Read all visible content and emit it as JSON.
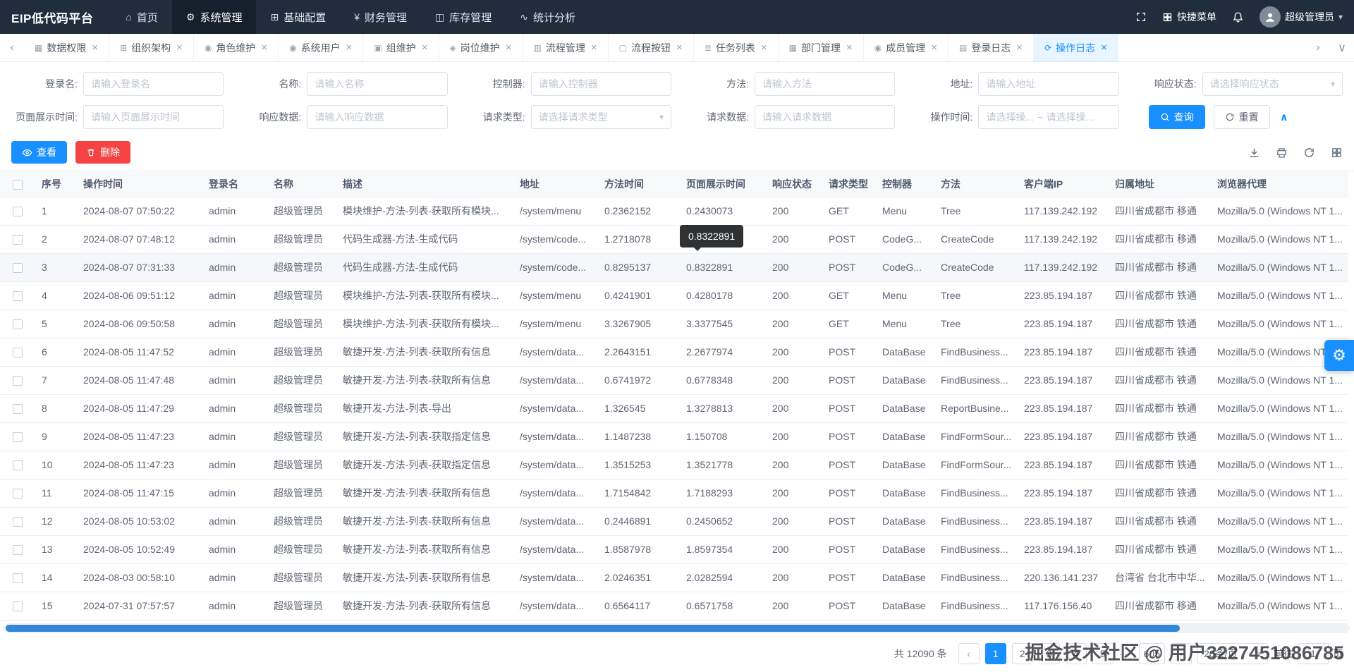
{
  "colors": {
    "primary": "#1890ff",
    "danger": "#f54343",
    "navbar_bg": "#1f2d3d",
    "active_tab_bg": "#e8f4ff",
    "tooltip_bg": "#303133",
    "scrollbar_thumb": "#3385d6"
  },
  "navbar": {
    "logo": "EIP低代码平台",
    "items": [
      {
        "key": "home",
        "label": "首页",
        "icon": "home-icon",
        "glyph": "⌂",
        "active": false
      },
      {
        "key": "system",
        "label": "系统管理",
        "icon": "system-gear-icon",
        "glyph": "⚙",
        "active": true
      },
      {
        "key": "base-config",
        "label": "基础配置",
        "icon": "base-config-icon",
        "glyph": "⊞",
        "active": false
      },
      {
        "key": "finance",
        "label": "财务管理",
        "icon": "finance-icon",
        "glyph": "¥",
        "active": false
      },
      {
        "key": "inventory",
        "label": "库存管理",
        "icon": "inventory-icon",
        "glyph": "◫",
        "active": false
      },
      {
        "key": "stats",
        "label": "统计分析",
        "icon": "stats-icon",
        "glyph": "∿",
        "active": false
      }
    ],
    "quick_menu_label": "快捷菜单",
    "user_name": "超级管理员"
  },
  "tabs": [
    {
      "key": "data-permission",
      "label": "数据权限",
      "icon": "data-grid-icon",
      "glyph": "▦",
      "active": false
    },
    {
      "key": "org-structure",
      "label": "组织架构",
      "icon": "org-icon",
      "glyph": "⊞",
      "active": false
    },
    {
      "key": "role-maintain",
      "label": "角色维护",
      "icon": "role-icon",
      "glyph": "◉",
      "active": false
    },
    {
      "key": "system-user",
      "label": "系统用户",
      "icon": "user-icon",
      "glyph": "◉",
      "active": false
    },
    {
      "key": "group-maintain",
      "label": "组维护",
      "icon": "group-icon",
      "glyph": "▣",
      "active": false
    },
    {
      "key": "position-maintain",
      "label": "岗位维护",
      "icon": "position-icon",
      "glyph": "◈",
      "active": false
    },
    {
      "key": "process-manage",
      "label": "流程管理",
      "icon": "process-icon",
      "glyph": "▥",
      "active": false
    },
    {
      "key": "process-button",
      "label": "流程按钮",
      "icon": "process-button-icon",
      "glyph": "▢",
      "active": false
    },
    {
      "key": "task-list",
      "label": "任务列表",
      "icon": "task-list-icon",
      "glyph": "≣",
      "active": false
    },
    {
      "key": "department-manage",
      "label": "部门管理",
      "icon": "department-icon",
      "glyph": "▦",
      "active": false
    },
    {
      "key": "member-manage",
      "label": "成员管理",
      "icon": "member-icon",
      "glyph": "◉",
      "active": false
    },
    {
      "key": "login-log",
      "label": "登录日志",
      "icon": "login-log-icon",
      "glyph": "▤",
      "active": false
    },
    {
      "key": "operation-log",
      "label": "操作日志",
      "icon": "loading-refresh-icon",
      "glyph": "⟳",
      "active": true
    }
  ],
  "search": {
    "rows": [
      [
        {
          "key": "login-name",
          "label": "登录名:",
          "placeholder": "请输入登录名",
          "type": "input"
        },
        {
          "key": "name",
          "label": "名称:",
          "placeholder": "请输入名称",
          "type": "input"
        },
        {
          "key": "controller",
          "label": "控制器:",
          "placeholder": "请输入控制器",
          "type": "input"
        },
        {
          "key": "method",
          "label": "方法:",
          "placeholder": "请输入方法",
          "type": "input"
        },
        {
          "key": "address",
          "label": "地址:",
          "placeholder": "请输入地址",
          "type": "input"
        },
        {
          "key": "response-status",
          "label": "响应状态:",
          "placeholder": "请选择响应状态",
          "type": "select"
        }
      ],
      [
        {
          "key": "page-display-time",
          "label": "页面展示时间:",
          "placeholder": "请输入页面展示时间",
          "type": "input"
        },
        {
          "key": "response-data",
          "label": "响应数据:",
          "placeholder": "请输入响应数据",
          "type": "input"
        },
        {
          "key": "request-type",
          "label": "请求类型:",
          "placeholder": "请选择请求类型",
          "type": "select"
        },
        {
          "key": "request-data",
          "label": "请求数据:",
          "placeholder": "请输入请求数据",
          "type": "input"
        },
        {
          "key": "operation-time",
          "label": "操作时间:",
          "placeholder_start": "请选择操...",
          "separator": "~",
          "placeholder_end": "请选择操...",
          "type": "range"
        }
      ]
    ],
    "query_label": "查询",
    "reset_label": "重置"
  },
  "toolbar": {
    "view_label": "查看",
    "delete_label": "删除",
    "icon_buttons": [
      "download-icon",
      "printer-icon",
      "refresh-icon",
      "column-settings-icon"
    ]
  },
  "table": {
    "columns": [
      "序号",
      "操作时间",
      "登录名",
      "名称",
      "描述",
      "地址",
      "方法时间",
      "页面展示时间",
      "响应状态",
      "请求类型",
      "控制器",
      "方法",
      "客户端IP",
      "归属地址",
      "浏览器代理"
    ],
    "hovered_row_index": 2,
    "rows": [
      [
        "1",
        "2024-08-07 07:50:22",
        "admin",
        "超级管理员",
        "模块维护-方法-列表-获取所有模块...",
        "/system/menu",
        "0.2362152",
        "0.2430073",
        "200",
        "GET",
        "Menu",
        "Tree",
        "117.139.242.192",
        "四川省成都市 移通",
        "Mozilla/5.0 (Windows NT 1..."
      ],
      [
        "2",
        "2024-08-07 07:48:12",
        "admin",
        "超级管理员",
        "代码生成器-方法-生成代码",
        "/system/code...",
        "1.2718078",
        "",
        "200",
        "POST",
        "CodeG...",
        "CreateCode",
        "117.139.242.192",
        "四川省成都市 移通",
        "Mozilla/5.0 (Windows NT 1..."
      ],
      [
        "3",
        "2024-08-07 07:31:33",
        "admin",
        "超级管理员",
        "代码生成器-方法-生成代码",
        "/system/code...",
        "0.8295137",
        "0.8322891",
        "200",
        "POST",
        "CodeG...",
        "CreateCode",
        "117.139.242.192",
        "四川省成都市 移通",
        "Mozilla/5.0 (Windows NT 1..."
      ],
      [
        "4",
        "2024-08-06 09:51:12",
        "admin",
        "超级管理员",
        "模块维护-方法-列表-获取所有模块...",
        "/system/menu",
        "0.4241901",
        "0.4280178",
        "200",
        "GET",
        "Menu",
        "Tree",
        "223.85.194.187",
        "四川省成都市 铁通",
        "Mozilla/5.0 (Windows NT 1..."
      ],
      [
        "5",
        "2024-08-06 09:50:58",
        "admin",
        "超级管理员",
        "模块维护-方法-列表-获取所有模块...",
        "/system/menu",
        "3.3267905",
        "3.3377545",
        "200",
        "GET",
        "Menu",
        "Tree",
        "223.85.194.187",
        "四川省成都市 铁通",
        "Mozilla/5.0 (Windows NT 1..."
      ],
      [
        "6",
        "2024-08-05 11:47:52",
        "admin",
        "超级管理员",
        "敏捷开发-方法-列表-获取所有信息",
        "/system/data...",
        "2.2643151",
        "2.2677974",
        "200",
        "POST",
        "DataBase",
        "FindBusiness...",
        "223.85.194.187",
        "四川省成都市 铁通",
        "Mozilla/5.0 (Windows NT 1..."
      ],
      [
        "7",
        "2024-08-05 11:47:48",
        "admin",
        "超级管理员",
        "敏捷开发-方法-列表-获取所有信息",
        "/system/data...",
        "0.6741972",
        "0.6778348",
        "200",
        "POST",
        "DataBase",
        "FindBusiness...",
        "223.85.194.187",
        "四川省成都市 铁通",
        "Mozilla/5.0 (Windows NT 1..."
      ],
      [
        "8",
        "2024-08-05 11:47:29",
        "admin",
        "超级管理员",
        "敏捷开发-方法-列表-导出",
        "/system/data...",
        "1.326545",
        "1.3278813",
        "200",
        "POST",
        "DataBase",
        "ReportBusine...",
        "223.85.194.187",
        "四川省成都市 铁通",
        "Mozilla/5.0 (Windows NT 1..."
      ],
      [
        "9",
        "2024-08-05 11:47:23",
        "admin",
        "超级管理员",
        "敏捷开发-方法-列表-获取指定信息",
        "/system/data...",
        "1.1487238",
        "1.150708",
        "200",
        "POST",
        "DataBase",
        "FindFormSour...",
        "223.85.194.187",
        "四川省成都市 铁通",
        "Mozilla/5.0 (Windows NT 1..."
      ],
      [
        "10",
        "2024-08-05 11:47:23",
        "admin",
        "超级管理员",
        "敏捷开发-方法-列表-获取指定信息",
        "/system/data...",
        "1.3515253",
        "1.3521778",
        "200",
        "POST",
        "DataBase",
        "FindFormSour...",
        "223.85.194.187",
        "四川省成都市 铁通",
        "Mozilla/5.0 (Windows NT 1..."
      ],
      [
        "11",
        "2024-08-05 11:47:15",
        "admin",
        "超级管理员",
        "敏捷开发-方法-列表-获取所有信息",
        "/system/data...",
        "1.7154842",
        "1.7188293",
        "200",
        "POST",
        "DataBase",
        "FindBusiness...",
        "223.85.194.187",
        "四川省成都市 铁通",
        "Mozilla/5.0 (Windows NT 1..."
      ],
      [
        "12",
        "2024-08-05 10:53:02",
        "admin",
        "超级管理员",
        "敏捷开发-方法-列表-获取所有信息",
        "/system/data...",
        "0.2446891",
        "0.2450652",
        "200",
        "POST",
        "DataBase",
        "FindBusiness...",
        "223.85.194.187",
        "四川省成都市 铁通",
        "Mozilla/5.0 (Windows NT 1..."
      ],
      [
        "13",
        "2024-08-05 10:52:49",
        "admin",
        "超级管理员",
        "敏捷开发-方法-列表-获取所有信息",
        "/system/data...",
        "1.8587978",
        "1.8597354",
        "200",
        "POST",
        "DataBase",
        "FindBusiness...",
        "223.85.194.187",
        "四川省成都市 铁通",
        "Mozilla/5.0 (Windows NT 1..."
      ],
      [
        "14",
        "2024-08-03 00:58:10",
        "admin",
        "超级管理员",
        "敏捷开发-方法-列表-获取所有信息",
        "/system/data...",
        "2.0246351",
        "2.0282594",
        "200",
        "POST",
        "DataBase",
        "FindBusiness...",
        "220.136.141.237",
        "台湾省 台北市中华...",
        "Mozilla/5.0 (Windows NT 1..."
      ],
      [
        "15",
        "2024-07-31 07:57:57",
        "admin",
        "超级管理员",
        "敏捷开发-方法-列表-获取所有信息",
        "/system/data...",
        "0.6564117",
        "0.6571758",
        "200",
        "POST",
        "DataBase",
        "FindBusiness...",
        "117.176.156.40",
        "四川省成都市 移通",
        "Mozilla/5.0 (Windows NT 1..."
      ]
    ]
  },
  "tooltip": {
    "text": "0.8322891"
  },
  "pagination": {
    "total_text": "共 12090 条",
    "pages": [
      "1",
      "2",
      "3",
      "4",
      "5"
    ],
    "active_page": "1",
    "ellipsis": "···",
    "last_page": "605",
    "page_size": "20条/页",
    "goto_prefix": "前往",
    "goto_value": "1",
    "goto_suffix": "页"
  },
  "watermark": "掘金技术社区 @ 用户3227451086785"
}
